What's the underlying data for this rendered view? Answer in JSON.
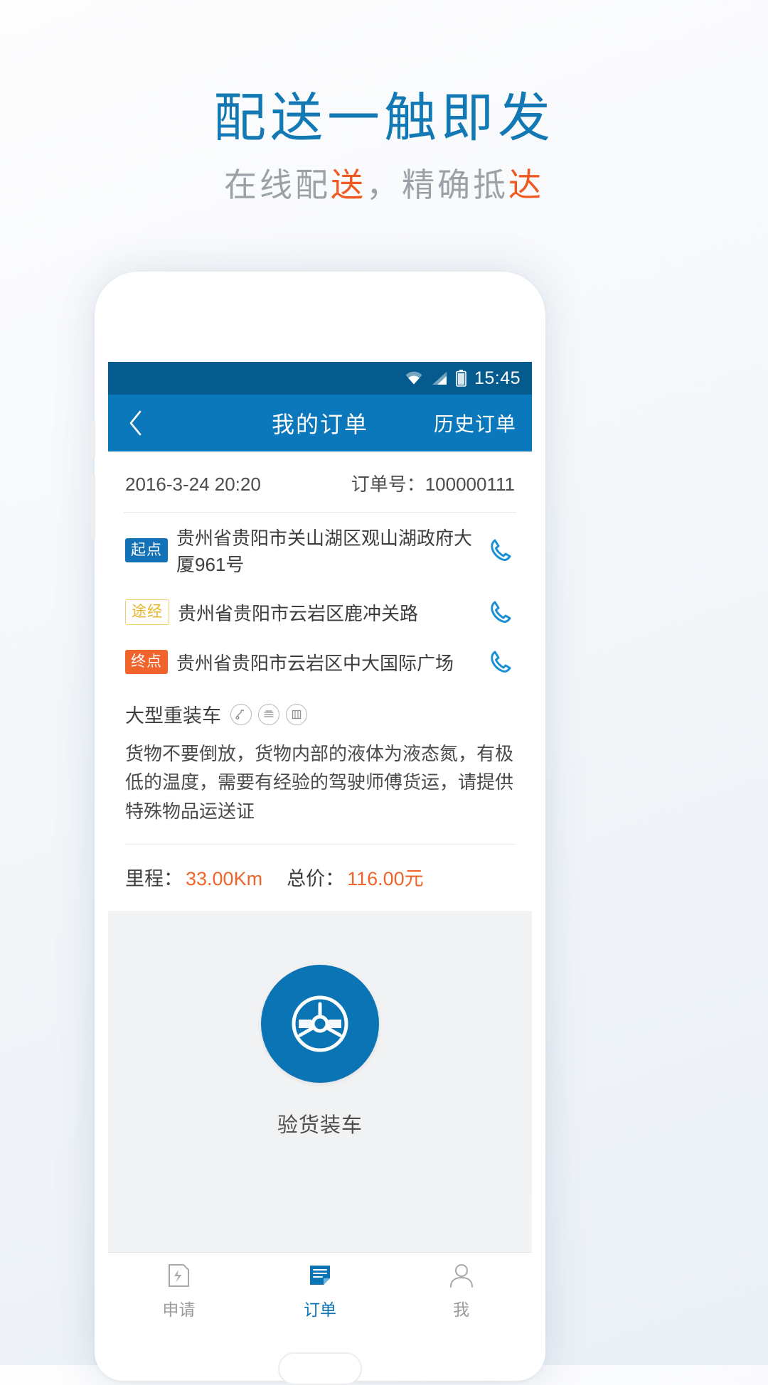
{
  "promo": {
    "title": "配送一触即发",
    "subtitle_parts": [
      {
        "text": "在线配",
        "highlight": false
      },
      {
        "text": "送",
        "highlight": true
      },
      {
        "text": "，精确抵",
        "highlight": false
      },
      {
        "text": "达",
        "highlight": true
      }
    ],
    "subtitle_plain": "在线配送，精确抵达",
    "sub_1": "在线配",
    "sub_2": "送",
    "sub_3": "，精确抵",
    "sub_4": "达",
    "title_color": "#1379b4",
    "sub_color": "#9aa2a8",
    "accent_color": "#f05a22"
  },
  "statusbar": {
    "time": "15:45",
    "icons": [
      "wifi-icon",
      "signal-icon",
      "battery-icon"
    ]
  },
  "navbar": {
    "back_icon": "‹",
    "title": "我的订单",
    "right_action": "历史订单",
    "bg_color": "#0a78ba",
    "status_bg_color": "#065b8e"
  },
  "order": {
    "datetime": "2016-3-24  20:20",
    "order_no_label": "订单号：",
    "order_no": "100000111",
    "addresses": [
      {
        "badge": "起点",
        "badge_type": "start",
        "text": "贵州省贵阳市关山湖区观山湖政府大厦961号",
        "call_icon": "phone-icon"
      },
      {
        "badge": "途经",
        "badge_type": "via",
        "text": "贵州省贵阳市云岩区鹿冲关路",
        "call_icon": "phone-icon"
      },
      {
        "badge": "终点",
        "badge_type": "end",
        "text": "贵州省贵阳市云岩区中大国际广场",
        "call_icon": "phone-icon"
      }
    ],
    "vehicle_name": "大型重装车",
    "vehicle_tag_icons": [
      "hook-icon",
      "liquid-icon",
      "board-icon"
    ],
    "note": "货物不要倒放，货物内部的液体为液态氮，有极低的温度，需要有经验的驾驶师傅货运，请提供特殊物品运送证",
    "mileage_label": "里程：",
    "mileage_value": "33.00Km",
    "price_label": "总价：",
    "price_value": "116.00元",
    "value_color": "#f0632a"
  },
  "action": {
    "button_icon": "steering-wheel-icon",
    "button_label": "验货装车",
    "button_color": "#0a74b4"
  },
  "tabbar": {
    "items": [
      {
        "label": "申请",
        "icon": "apply-icon",
        "active": false
      },
      {
        "label": "订单",
        "icon": "order-list-icon",
        "active": true
      },
      {
        "label": "我",
        "icon": "person-icon",
        "active": false
      }
    ],
    "active_color": "#0a74b4",
    "inactive_color": "#9b9b9b"
  }
}
